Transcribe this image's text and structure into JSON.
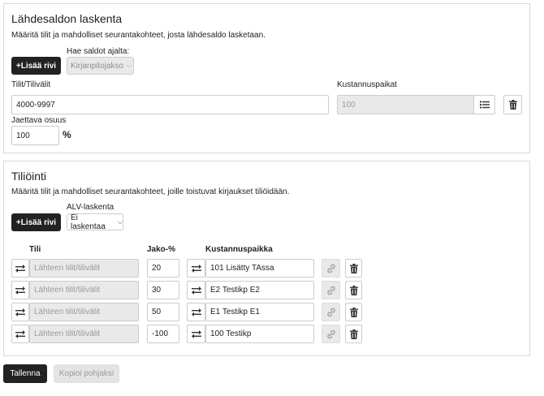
{
  "source_section": {
    "title": "Lähdesaldon laskenta",
    "description": "Määritä tilit ja mahdolliset seurantakohteet, josta lähdesaldo lasketaan.",
    "add_row_label": "+Lisää rivi",
    "period_label": "Hae saldot ajalta:",
    "period_value": "Kirjanpitojakso",
    "accounts_label": "Tilit/Tilivälit",
    "accounts_value": "4000-9997",
    "cost_centers_label": "Kustannuspaikat",
    "cost_centers_value": "100",
    "share_label": "Jaettava osuus",
    "share_value": "100",
    "share_unit": "%"
  },
  "posting_section": {
    "title": "Tiliöinti",
    "description": "Määritä tilit ja mahdolliset seurantakohteet, joille toistuvat kirjaukset tiliöidään.",
    "add_row_label": "+Lisää rivi",
    "vat_label": "ALV-laskenta",
    "vat_value": "Ei laskentaa",
    "columns": {
      "account": "Tili",
      "share": "Jako-%",
      "cost_center": "Kustannuspaikka"
    },
    "account_placeholder": "Lähteen tilit/tilivälit",
    "rows": [
      {
        "share": "20",
        "cost_center": "101 Lisätty TAssa"
      },
      {
        "share": "30",
        "cost_center": "E2 Testikp E2"
      },
      {
        "share": "50",
        "cost_center": "E1 Testikp E1"
      },
      {
        "share": "-100",
        "cost_center": "100 Testikp"
      }
    ]
  },
  "footer": {
    "save_label": "Tallenna",
    "copy_template_label": "Kopioi pohjaksi"
  },
  "icons": {
    "swap": "swap-icon",
    "list": "list-icon",
    "trash": "trash-icon",
    "link": "link-icon",
    "chevron": "chevron-down-icon"
  }
}
